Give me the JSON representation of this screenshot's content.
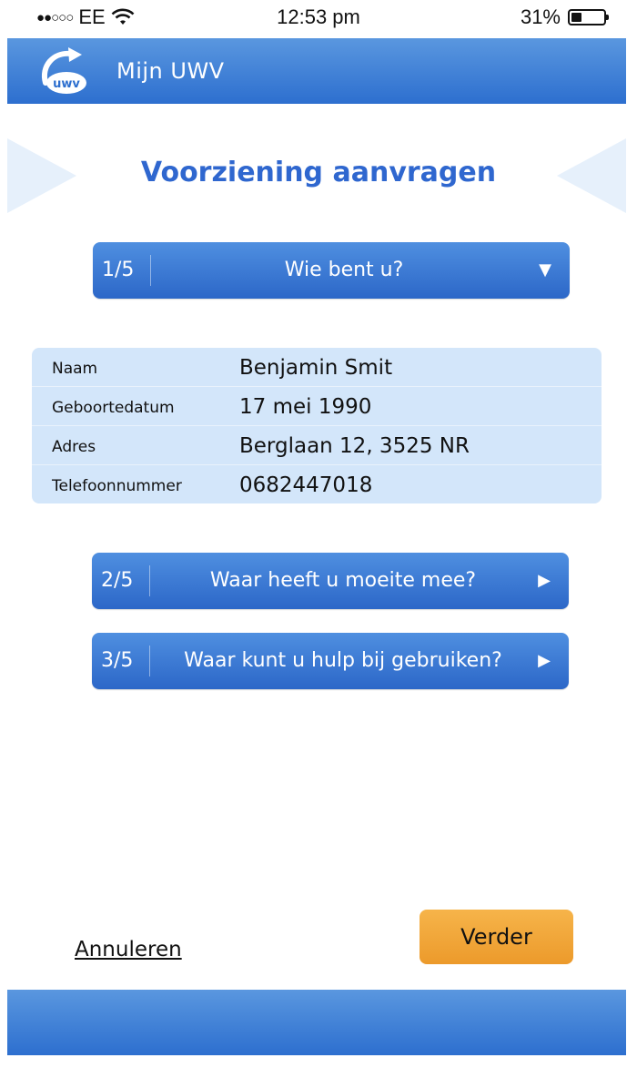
{
  "status_bar": {
    "signal_dots": "●●○○○",
    "carrier": "EE",
    "wifi_icon": "wifi-icon",
    "time": "12:53 pm",
    "battery_percent": "31%",
    "battery_level": 0.31
  },
  "app_bar": {
    "logo_text": "uwv",
    "title": "Mijn UWV"
  },
  "page": {
    "title": "Voorziening aanvragen"
  },
  "steps": [
    {
      "number": "1/5",
      "label": "Wie bent u?",
      "arrow": "▼"
    },
    {
      "number": "2/5",
      "label": "Waar heeft u moeite mee?",
      "arrow": "▶"
    },
    {
      "number": "3/5",
      "label": "Waar kunt u hulp bij gebruiken?",
      "arrow": "▶"
    }
  ],
  "personal_info": [
    {
      "label": "Naam",
      "value": "Benjamin Smit"
    },
    {
      "label": "Geboortedatum",
      "value": "17 mei 1990"
    },
    {
      "label": "Adres",
      "value": "Berglaan 12, 3525 NR"
    },
    {
      "label": "Telefoonnummer",
      "value": "0682447018"
    }
  ],
  "actions": {
    "cancel": "Annuleren",
    "next": "Verder"
  },
  "colors": {
    "primary_blue": "#2d6fcf",
    "title_blue": "#2f67cf",
    "info_background": "#d3e6fa",
    "next_button": "#f0a536"
  }
}
